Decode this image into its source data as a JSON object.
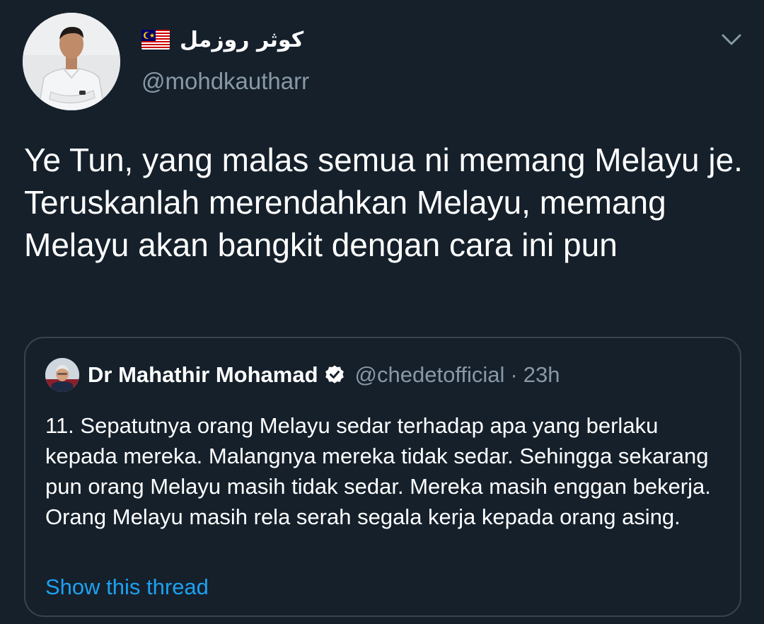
{
  "author": {
    "display_name": "كوثر روزمل",
    "flag_icon": "malaysia-flag-icon",
    "handle": "@mohdkautharr",
    "avatar_icon": "profile-avatar"
  },
  "menu": {
    "icon": "chevron-down-icon"
  },
  "tweet": {
    "text": "Ye Tun, yang malas semua ni memang Melayu je. Teruskanlah merendahkan Melayu, memang Melayu akan bangkit dengan cara ini pun"
  },
  "quoted_tweet": {
    "display_name": "Dr Mahathir Mohamad",
    "verified_icon": "verified-badge-icon",
    "handle": "@chedetofficial",
    "separator": "·",
    "time": "23h",
    "text": "11. Sepatutnya orang Melayu sedar terhadap apa yang berlaku kepada mereka. Malangnya mereka tidak sedar. Sehingga sekarang pun orang Melayu masih tidak sedar. Mereka masih enggan bekerja. Orang Melayu masih rela serah segala kerja kepada orang asing.",
    "show_thread": "Show this thread"
  },
  "colors": {
    "background": "#15202b",
    "text_primary": "#ffffff",
    "text_secondary": "#8899a6",
    "link": "#1da1f2",
    "border": "#38444d"
  }
}
